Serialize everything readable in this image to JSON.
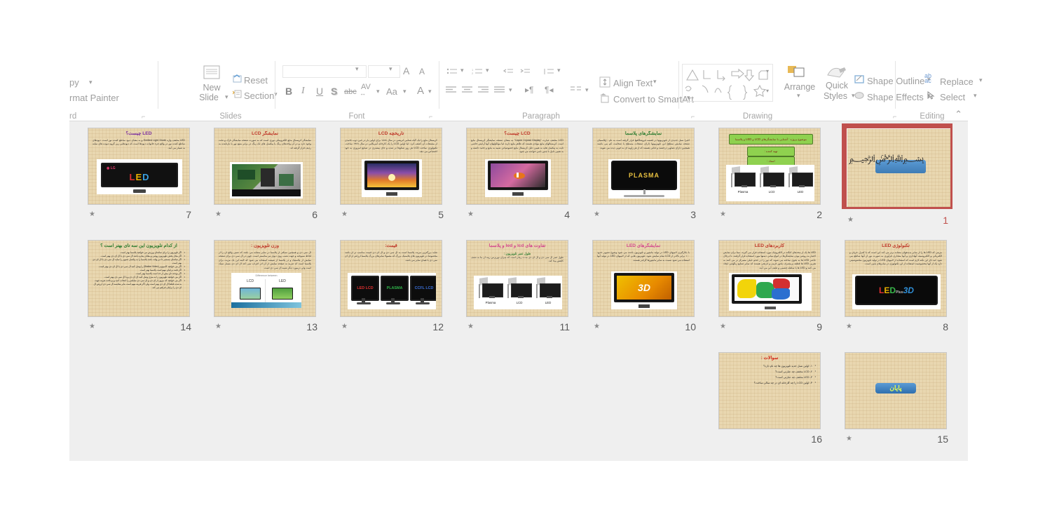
{
  "app": {
    "name": "Microsoft PowerPoint",
    "view": "Slide Sorter"
  },
  "ribbon": {
    "groups": [
      {
        "name": "clipboard",
        "title": "rd"
      },
      {
        "name": "slides",
        "title": "Slides"
      },
      {
        "name": "font",
        "title": "Font"
      },
      {
        "name": "paragraph",
        "title": "Paragraph"
      },
      {
        "name": "drawing",
        "title": "Drawing"
      },
      {
        "name": "editing",
        "title": "Editing"
      }
    ],
    "clipboard": {
      "copy": "py",
      "format_painter": "rmat Painter"
    },
    "slides": {
      "new_slide_line1": "New",
      "new_slide_line2": "Slide",
      "reset": "Reset",
      "section": "Section"
    },
    "font": {
      "bold": "B",
      "italic": "I",
      "underline": "U",
      "shadow": "S",
      "strike": "abc",
      "spacing": "AV",
      "change_case": "Aa",
      "grow": "A",
      "shrink": "A",
      "color": "A"
    },
    "paragraph": {
      "align_text": "Align Text",
      "convert_smartart": "Convert to SmartArt"
    },
    "drawing": {
      "arrange": "Arrange",
      "quick_styles_1": "Quick",
      "quick_styles_2": "Styles",
      "shape_outline": "Shape Outline",
      "shape_effects": "Shape Effects"
    },
    "editing": {
      "replace": "Replace",
      "replace_icon": "ab",
      "replace_icon2": "ac",
      "select": "Select"
    },
    "collapse_icon": "chevron-up"
  },
  "sorter": {
    "background": "#efefef",
    "selected_slide": 1,
    "selection_color": "#c0504d",
    "slides": [
      {
        "number": "7",
        "has_star": true,
        "row": 0,
        "col": 0,
        "title": "LED چیست؟",
        "title_color": "#7b2fa0",
        "body": "LED مخفف واژه Emitted Light Diode و به معنای دیود ساطع کننده نور است. دیودهای ساطع کننده نور در واقع جزء خانواده دیودها است که دیودهایی زیر گروه دیوده های نمایه به شمار می آیند.",
        "media": "lg-led-tv",
        "media_label": "LED"
      },
      {
        "number": "6",
        "has_star": true,
        "row": 0,
        "col": 1,
        "title": "نمایشگر LCD",
        "title_color": "#c0392b",
        "body": "نمایشگر کریستال مایع الکترونیکی نوری است که به صورت صفحه نمایشگر نازک و تخت وجود دارد و در آن واحدهای رنگ یا پیکسل های تک رنگ در برابر منبع نور یا بازتابنده به ردیف قرار گرفته اند.",
        "media": "circuit-board"
      },
      {
        "number": "5",
        "has_star": true,
        "row": 0,
        "col": 2,
        "title": "تاریخچه LCD",
        "title_color": "#c0392b",
        "body": "کریستال مایع را یک گیاه شناس اتریشی در سال ۱۸۸۸ برای اولین بار در حین ذوب جامدی از مشتقات آن کشف کرد. اما اولین LCD را یک کارخانه آمریکایی در سال ۱۹۶۸ ساخت. تکنولوژی ساخت LCD هر روز شکوفا تر شده و جای بیشتری در صنایع امروزی به خود اختصاص می دهد.",
        "media": "samsung-sunset-tv"
      },
      {
        "number": "4",
        "has_star": true,
        "row": 0,
        "col": 3,
        "title": "LCD چیست؟",
        "title_color": "#c0392b",
        "body": "LCD مخفف عبارت \"Liquid Crystal Display\" به معنای صفحه نمایشگر کریستال مایع است. کریستالهای مایع موادی هستند که ظاهر مایع دارند اما مولکولهای آنها آرایش خاصی ثابت به پیکسل هایه به همین دلیل کریستال مایع خصوصیاتی شبیه به مایع و جامد داشته و به همین دلیل با چنین نامی خوانده می شود.",
        "media": "clownfish-tv"
      },
      {
        "number": "3",
        "has_star": true,
        "row": 0,
        "col": 4,
        "title": "نمایشگرهای پلاسما",
        "title_color": "#2e7d32",
        "body": "اخیرا نسل جدیدی از تلویزیونها در قفسه فروشگاهها قرار گرفته است به نام : (پلاسمای صفحه نمایش سطح) این تلویزیونها دارای صفحات مسطح با ضخامت کم می باشند همچنین دارای تصاویر درخشند و تابانی هستند که از هر زاویه ای به خوبی دیده می شوند.",
        "media": "plasma-tv",
        "media_label": "PLASMA"
      },
      {
        "number": "2",
        "has_star": true,
        "row": 0,
        "col": 5,
        "title": "",
        "title_color": "#7b1a10",
        "green_boxes": [
          "موضوع پروژه : آشنایی با نمایشگرهای LCD و LED و پلاسما",
          "تهیه کننده :",
          "استاد :"
        ],
        "media": "three-tvs",
        "tv_labels": [
          "Plasma",
          "LCD",
          "LED"
        ]
      },
      {
        "number": "1",
        "has_star": true,
        "row": 0,
        "col": 6,
        "title": "",
        "selected": true,
        "media": "bismillah-calligraphy"
      },
      {
        "number": "14",
        "has_star": true,
        "row": 1,
        "col": 0,
        "title": "از کدام تلویزیون این سه تای بهتر است ؟",
        "title_color": "#2e7d32",
        "bullets": [
          "اگر تلویزیون را برای تماشای ورزش می خواهید پلاسما بهتر است.",
          "اگر محل پخش تلویزیون روشن و مقابل پنجره باشد ال سی دی یا ال ای دی بهتر است.",
          "اگر تماشای مستمر تا دیر وقت باشد پلاسما را به پیکسل تصویر را نمایه ال سی دی یا ال ای دی بهتر است.",
          "اگر می خواهید کامپیوتر (Station Video) را وصل کنید ال سی دی یا ال ای دی بهتر است.",
          "اگر قصد برایتان مهم است پلاسما بهتر است.",
          "اگر بودجه تان بیش از حد است پلاسما بهتر است.",
          "اگر می خواهید تلویزیون را به منزل وصل کنید ال ای دی و یا ال سی دی بهتر است.",
          "اگر می خواهید که بیرون از ای دی و ال سی دی تمایلش را انتخاب کنید و پرداخت هزینه جهت به شده قطعا ال ای دی بهتر است ولی اگر هزینه مهم است بنابر مقایسه ال سی دی ارزش ال ای دی را برایتان فراهم می کند."
        ]
      },
      {
        "number": "13",
        "has_star": true,
        "row": 1,
        "col": 1,
        "title": "وزن تلویزیون :",
        "title_color": "#c0392b",
        "body": "ال سی دی و همچنین سبکتر از پلاسما در سایز مشابه می باشد که ضمن واقع آن را از لحاظ نسوخته و جهت نصب روی دیوار نیز مناسبتر است. چون در ال سی دی برای صفحه نمایش از پلاستیک و در پلاسما از شیشه استفاده می شود که البته این یک مزیت برای پلاسما است که ضربه به صفحه نمایش از آن اثر اعراب نمی کند ال ای دی بسیار سبک است ولی درمورد دیگر شبیه ال سی دی است.",
        "media": "lcd-vs-led",
        "media_caption": "Difference between",
        "tv_labels": [
          "LCD",
          "LED"
        ]
      },
      {
        "number": "12",
        "has_star": true,
        "row": 1,
        "col": 2,
        "title": "قیمت:",
        "title_color": "#c0392b",
        "body": "شاید بزرگترین مزیت پلاسما است به ال سی دی و ال ای دی قیمت مناسب تر آن باشد مخصوصا در تلویزیون های پلاستیک بزرگ که معمولا سایزهای بزرگ پلاسما ارزانتر از ال ای سی دی با همان سایز می باشد.",
        "media": "three-labeled-tvs",
        "tv_labels": [
          "LED LCD",
          "PLASMA",
          "CCFL LCD"
        ],
        "tv_label_colors": [
          "#e03030",
          "#2fb24a",
          "#3b6fd8"
        ]
      },
      {
        "number": "11",
        "has_star": true,
        "row": 1,
        "col": 3,
        "title": "تفاوت های lcd و led و پلاسما",
        "title_color": "#d44a8f",
        "subtitle": "طول عمر تلویزیون :",
        "subtitle_color": "#2e7d32",
        "body": "طول عمر ال سی دی و ال ای دی مدت زمان است که میزان نورپرس زیبه آن ما به نصف کاهش پیدا کند.",
        "media": "three-tvs",
        "tv_labels": [
          "Plasma",
          "LCD",
          "LED"
        ]
      },
      {
        "number": "10",
        "has_star": true,
        "row": 1,
        "col": 4,
        "title": "نمایشگرهای LED",
        "title_color": "#d44a8f",
        "body": "با بکارگیری لامپهای LED در تولید مانیتور و تلویزیون باعث می شود وضوح تصویر حدود ۱۰۰ برابر بالاتر از LCD تمام نمایش شود. تلویزیون هایی که از لامپهای LED در تولید آنها استفاده می شود نسبت به سایر مانیتورها گرانتر هستند.",
        "media": "3d-tv",
        "media_label": "3D"
      },
      {
        "number": "9",
        "has_star": true,
        "row": 1,
        "col": 5,
        "title": "کاربردهای LED",
        "title_color": "#c0392b",
        "body": "LED ها یک از محدهای کنگنه در الکترونیک مورد استفاده قرار می گیرند. مبنا برای نمایش اختیار به روشن بودن نمایشگرها در انواع میانی دستها مورد استفاده قرار گرفتند. تا درحال حاضر LED ها به نحوی ساخته می شوند که نور را در حجم خیلی متمرکز تر می کنند به هنرین LED ها قطعه پرمصرف مانور قرمز و نارنجی هستند که سایر صنایع رنگهایی ایجاد می کنند و LED ها با سلطه چشمی و طیف آبی می آیند.",
        "media": "colorful-paint-tv"
      },
      {
        "number": "8",
        "has_star": true,
        "row": 1,
        "col": 6,
        "title": "تکنولوژی LED",
        "title_color": "#c0392b",
        "body": "مزیتی که LED ها را از سایر پدیدههای مشابه برتر می کند این است که با کنترل جریان و الکتریکی و الکتروسیته آنهاداری و آنها مقداری فرآوری به صورت نور از آنها ساطع می شود. لبه ذکر این نکته لازم است که استفاده از لامپهای LED در تولید تلویزیون مخصوصیتی دارد یک از آنها مخصوصیت استفاده از این تکنولوژی در سایزهای پایین است.",
        "media": "led-3d-plus-tv",
        "media_label": "LED 3D"
      },
      {
        "number": "16",
        "has_star": false,
        "row": 2,
        "col": 5,
        "title": "سوالات :",
        "title_color": "#d42a1a",
        "bullets": [
          "۱- اولین نسل جدید تلویزیون ها چه نام دارد؟",
          "۲- LCD مخفف چه عبارتی است؟",
          "۳- LED مخفف چه عبارتی است؟",
          "۴- اولین LCD را چه کارخانه ای در چه سالی ساخت؟"
        ]
      },
      {
        "number": "15",
        "has_star": true,
        "row": 2,
        "col": 6,
        "title": "",
        "media": "payan-banner",
        "media_label": "پایان"
      }
    ]
  }
}
